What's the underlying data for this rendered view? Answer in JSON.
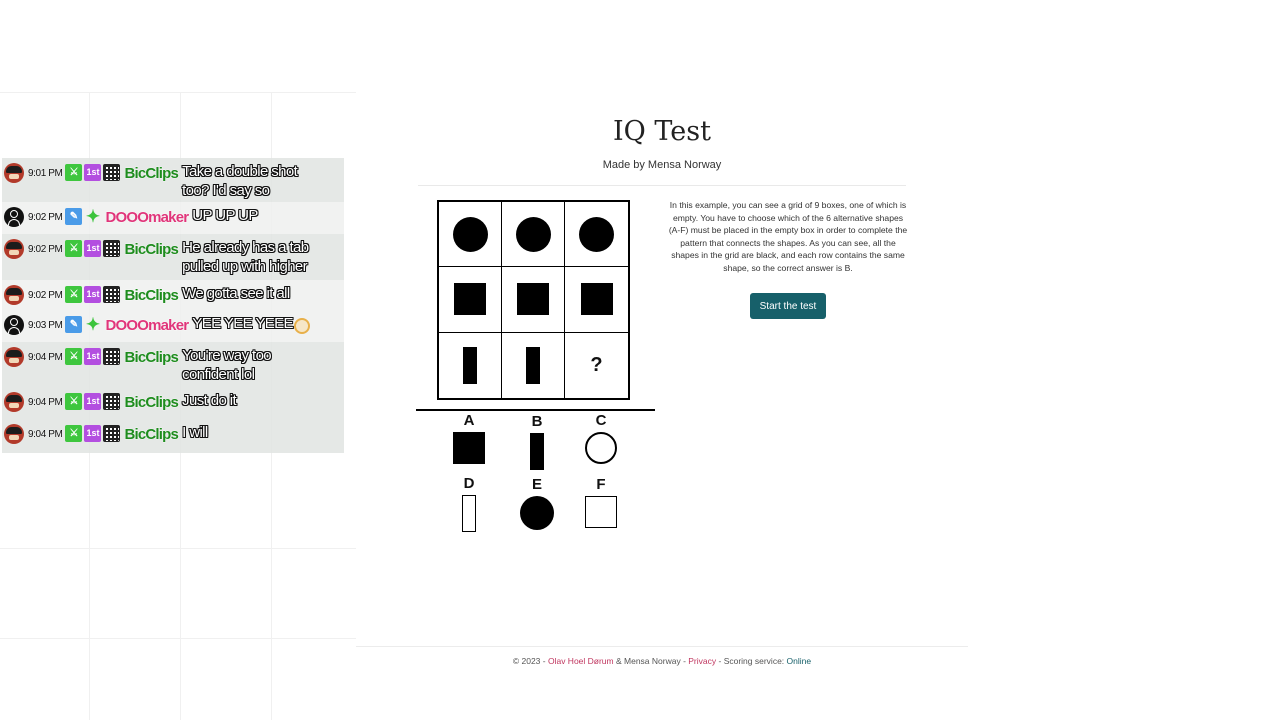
{
  "page": {
    "title": "IQ Test",
    "subtitle": "Made by Mensa Norway",
    "instructions": "In this example, you can see a grid of 9 boxes, one of which is empty. You have to choose which of the 6 alternative shapes (A-F) must be placed in the empty box in order to complete the pattern that connects the shapes. As you can see, all the shapes in the grid are black, and each row contains the same shape, so the correct answer is B.",
    "start_button": "Start the test",
    "question_mark": "?",
    "grid_rows": [
      [
        "filled-circle",
        "filled-circle",
        "filled-circle"
      ],
      [
        "filled-square",
        "filled-square",
        "filled-square"
      ],
      [
        "filled-bar",
        "filled-bar",
        "empty"
      ]
    ],
    "options": [
      {
        "letter": "A",
        "shape": "filled-square"
      },
      {
        "letter": "B",
        "shape": "filled-bar"
      },
      {
        "letter": "C",
        "shape": "outline-circle"
      },
      {
        "letter": "D",
        "shape": "outline-bar"
      },
      {
        "letter": "E",
        "shape": "filled-circle"
      },
      {
        "letter": "F",
        "shape": "outline-square"
      }
    ],
    "footer": {
      "copyright": "© 2023 - ",
      "author": "Olav Hoel Dørum",
      "and_org": " & Mensa Norway - ",
      "privacy": "Privacy",
      "scoring_label": " - Scoring service: ",
      "scoring_status": "Online"
    }
  },
  "chat": {
    "messages": [
      {
        "time": "9:01 PM",
        "user": "BicClips",
        "text": "Take a double shot too? I'd say so"
      },
      {
        "time": "9:02 PM",
        "user": "DOOOmaker",
        "text": "UP UP UP"
      },
      {
        "time": "9:02 PM",
        "user": "BicClips",
        "text": "He already has a tab pulled up with higher"
      },
      {
        "time": "9:02 PM",
        "user": "BicClips",
        "text": "We gotta see it all"
      },
      {
        "time": "9:03 PM",
        "user": "DOOOmaker",
        "text": "YEE YEE YEEE"
      },
      {
        "time": "9:04 PM",
        "user": "BicClips",
        "text": "You're way too confident lol"
      },
      {
        "time": "9:04 PM",
        "user": "BicClips",
        "text": "Just do it"
      },
      {
        "time": "9:04 PM",
        "user": "BicClips",
        "text": "I will"
      }
    ],
    "badge_text": {
      "sub_badge": "1st",
      "qr_badge": ""
    }
  },
  "colors": {
    "button": "#17606a",
    "footer_pink": "#c0365f",
    "name_green": "#1e8c1e",
    "name_pink": "#e0357a"
  }
}
